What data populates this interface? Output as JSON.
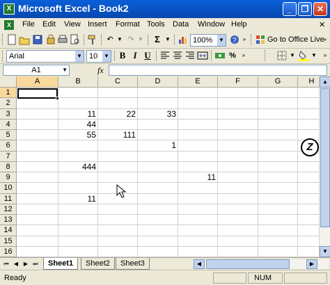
{
  "window": {
    "title": "Microsoft Excel - Book2",
    "app_icon": "X",
    "minimize": "_",
    "restore": "❐",
    "close": "✕"
  },
  "menu": {
    "items": [
      "File",
      "Edit",
      "View",
      "Insert",
      "Format",
      "Tools",
      "Data",
      "Window",
      "Help"
    ],
    "close_doc": "✕"
  },
  "toolbar_standard": {
    "zoom": "100%",
    "office_live_label": "Go to Office Live"
  },
  "toolbar_formatting": {
    "font": "Arial",
    "size": "10",
    "bold": "B",
    "italic": "I",
    "underline": "U"
  },
  "formula_bar": {
    "name_box": "A1",
    "fx_label": "fx"
  },
  "grid": {
    "columns": [
      "A",
      "B",
      "C",
      "D",
      "E",
      "F",
      "G",
      "H"
    ],
    "rows": [
      "1",
      "2",
      "3",
      "4",
      "5",
      "6",
      "7",
      "8",
      "9",
      "10",
      "11",
      "12",
      "13",
      "14",
      "15",
      "16"
    ],
    "cells": [
      {
        "row": 3,
        "col": "B",
        "value": "11"
      },
      {
        "row": 3,
        "col": "C",
        "value": "22"
      },
      {
        "row": 3,
        "col": "D",
        "value": "33"
      },
      {
        "row": 4,
        "col": "B",
        "value": "44"
      },
      {
        "row": 5,
        "col": "B",
        "value": "55"
      },
      {
        "row": 5,
        "col": "C",
        "value": "111"
      },
      {
        "row": 6,
        "col": "D",
        "value": "1"
      },
      {
        "row": 8,
        "col": "B",
        "value": "444"
      },
      {
        "row": 9,
        "col": "E",
        "value": "11"
      },
      {
        "row": 11,
        "col": "B",
        "value": "11"
      }
    ]
  },
  "sheets": {
    "tabs": [
      "Sheet1",
      "Sheet2",
      "Sheet3"
    ],
    "active": "Sheet1"
  },
  "status": {
    "text": "Ready",
    "num": "NUM"
  },
  "colors": {
    "title_bar": "#0a5fd8",
    "chrome": "#ece9d8",
    "grid_line": "#d0d0d0"
  }
}
